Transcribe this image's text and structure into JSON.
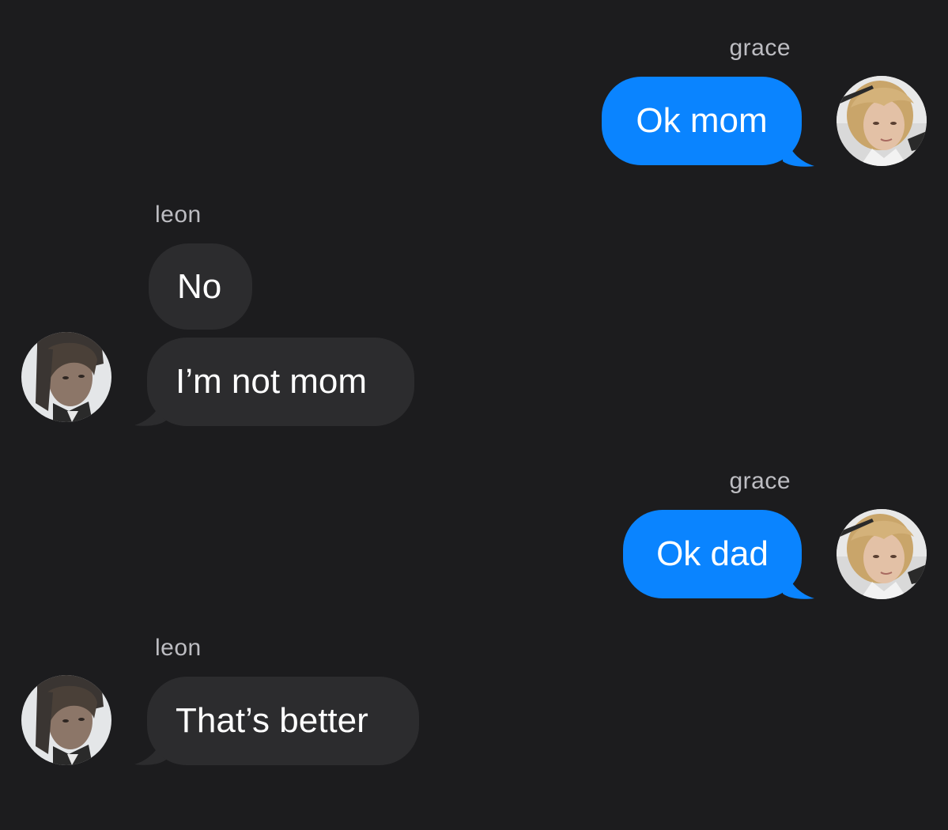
{
  "conversation": {
    "messages": [
      {
        "sender": "grace",
        "direction": "outgoing",
        "texts": [
          "Ok mom"
        ]
      },
      {
        "sender": "leon",
        "direction": "incoming",
        "texts": [
          "No",
          "I’m not mom"
        ]
      },
      {
        "sender": "grace",
        "direction": "outgoing",
        "texts": [
          "Ok dad"
        ]
      },
      {
        "sender": "leon",
        "direction": "incoming",
        "texts": [
          "That’s better"
        ]
      }
    ]
  },
  "colors": {
    "background": "#1c1c1e",
    "outgoing_bubble": "#0a84ff",
    "incoming_bubble": "#2c2c2e",
    "sender_label": "#bdbdc2"
  }
}
